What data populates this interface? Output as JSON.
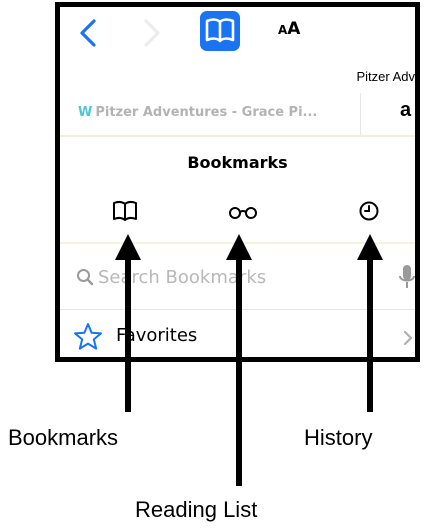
{
  "toolbar": {
    "back_icon": "chevron-left-icon",
    "forward_icon": "chevron-right-icon",
    "book_icon": "open-book-icon",
    "aa_small": "A",
    "aa_big": "A"
  },
  "url_peek": "Pitzer Adv",
  "tabs": {
    "active_title": "Pitzer Adventures - Grace Pi...",
    "active_favicon": "W",
    "second_logo": "a"
  },
  "panel": {
    "title": "Bookmarks",
    "segments": [
      {
        "name": "bookmarks",
        "icon": "open-book-icon"
      },
      {
        "name": "reading-list",
        "icon": "glasses-icon"
      },
      {
        "name": "history",
        "icon": "clock-icon"
      }
    ]
  },
  "search": {
    "placeholder": "Search Bookmarks",
    "value": ""
  },
  "favorites": {
    "label": "Favorites"
  },
  "captions": {
    "bookmarks": "Bookmarks",
    "history": "History",
    "reading_list": "Reading List"
  },
  "colors": {
    "accent": "#1a73f0",
    "muted": "#b8b8b8",
    "disabled": "#e6e6e6"
  }
}
